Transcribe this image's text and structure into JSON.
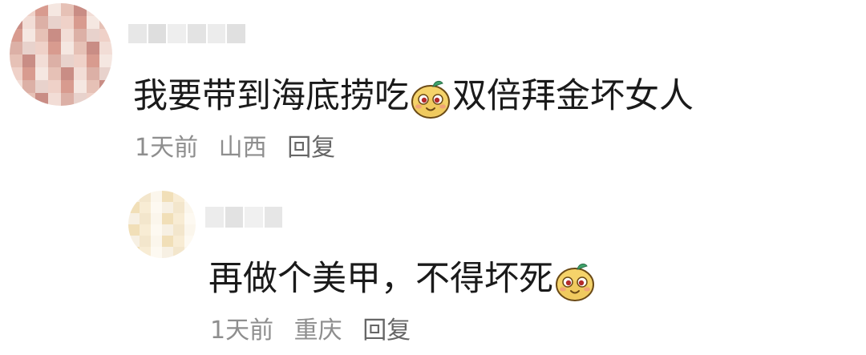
{
  "comments": [
    {
      "text_before": "我要带到海底捞吃",
      "emoji": "smiling-potato-emoji",
      "text_after": "双倍拜金坏女人",
      "time": "1天前",
      "location": "山西",
      "reply_label": "回复",
      "avatar_colors": [
        "#e8d2cc",
        "#dcb0a6",
        "#f2ddd6",
        "#c98d85",
        "#e6c1b6",
        "#f5e7e1",
        "#d89b8f",
        "#efd1c8"
      ],
      "username_colors": [
        "#e7e7e7",
        "#dedede",
        "#eeeeee",
        "#e3e3e3",
        "#ececec",
        "#e0e0e0"
      ]
    },
    {
      "text_before": "再做个美甲，不得坏死",
      "emoji": "smiling-potato-emoji",
      "text_after": "",
      "time": "1天前",
      "location": "重庆",
      "reply_label": "回复",
      "avatar_colors": [
        "#f7f0e3",
        "#f3e6cc",
        "#fbf6ec",
        "#f1dfb8",
        "#f8ecd4",
        "#fdf9f1"
      ],
      "username_colors": [
        "#ececec",
        "#e2e2e2",
        "#f0f0f0",
        "#e6e6e6"
      ]
    }
  ],
  "emoji_colors": {
    "face": "#f5d36a",
    "face_shadow": "#e8b94a",
    "outline": "#6b4a16",
    "leaf": "#3fa36b",
    "eye": "#b52a2a",
    "cheek": "#f19a7e"
  }
}
